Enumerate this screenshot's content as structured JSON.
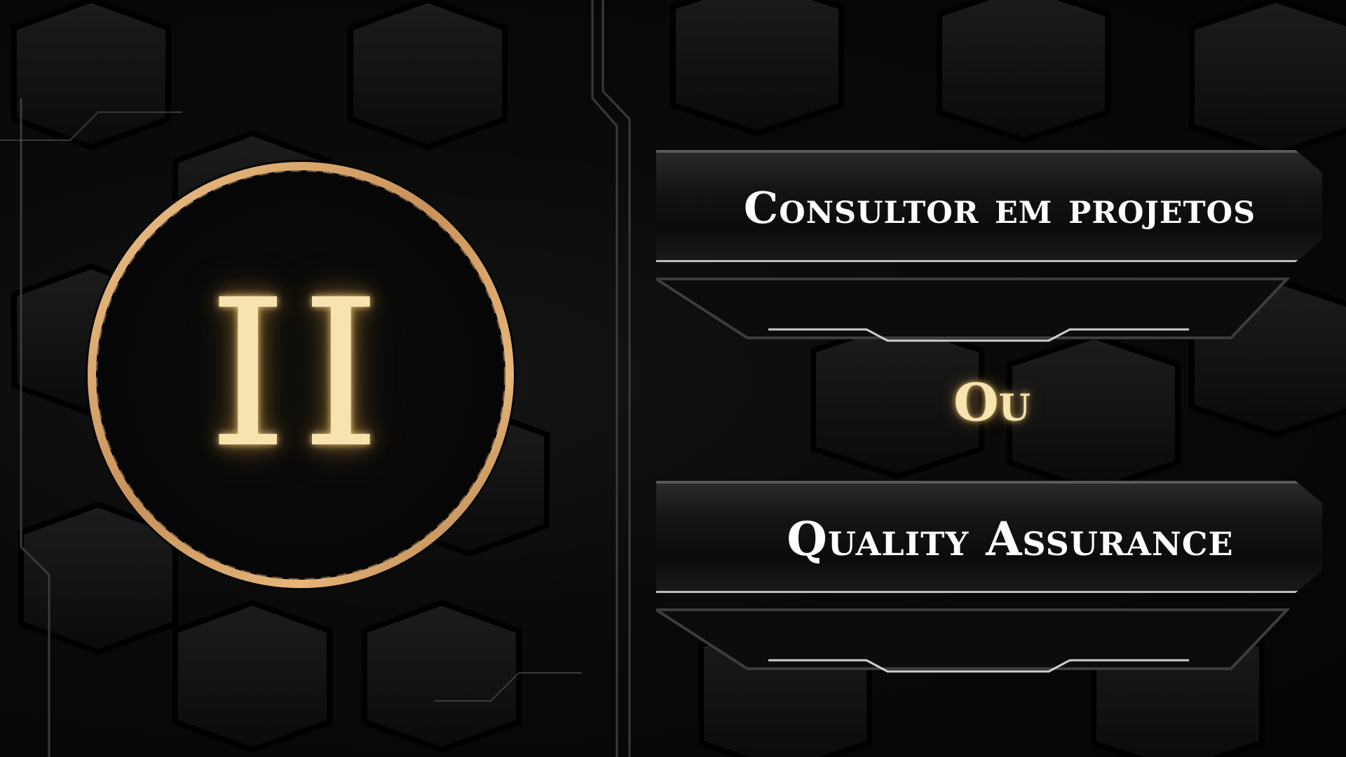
{
  "slide": {
    "numeral": "II",
    "option_one": "Consultor  em projetos",
    "separator": "Ou",
    "option_two": "Quality Assurance"
  },
  "colors": {
    "background": "#050505",
    "gold_glow": "#f6e3b0",
    "ring_gold": "#c8925a",
    "panel_text": "#ffffff"
  }
}
